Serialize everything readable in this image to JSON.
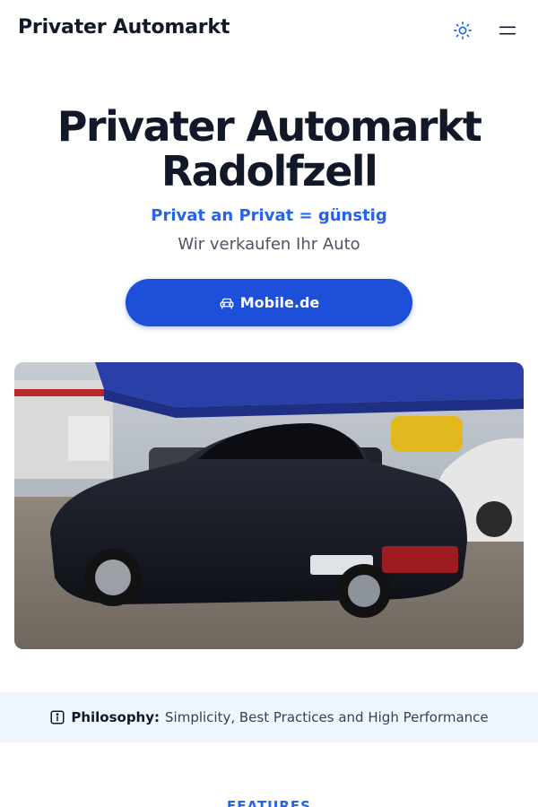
{
  "header": {
    "brand": "Privater Automarkt",
    "theme_toggle_icon": "sun-icon",
    "menu_icon": "menu-icon"
  },
  "hero": {
    "title_line1": "Privater Automarkt",
    "title_line2": "Radolfzell",
    "tagline": "Privat an Privat = günstig",
    "subtitle": "Wir verkaufen Ihr Auto",
    "cta": {
      "label": "Mobile.de",
      "icon": "car-icon"
    }
  },
  "hero_image": {
    "icon": "car-photo"
  },
  "philosophy": {
    "icon": "info-icon",
    "label": "Philosophy:",
    "text": "Simplicity, Best Practices and High Performance"
  },
  "features": {
    "label": "FEATURES"
  },
  "colors": {
    "accent": "#2563eb",
    "button": "#1d4fd8",
    "banner_bg": "#eff6ff",
    "text": "#111827"
  }
}
